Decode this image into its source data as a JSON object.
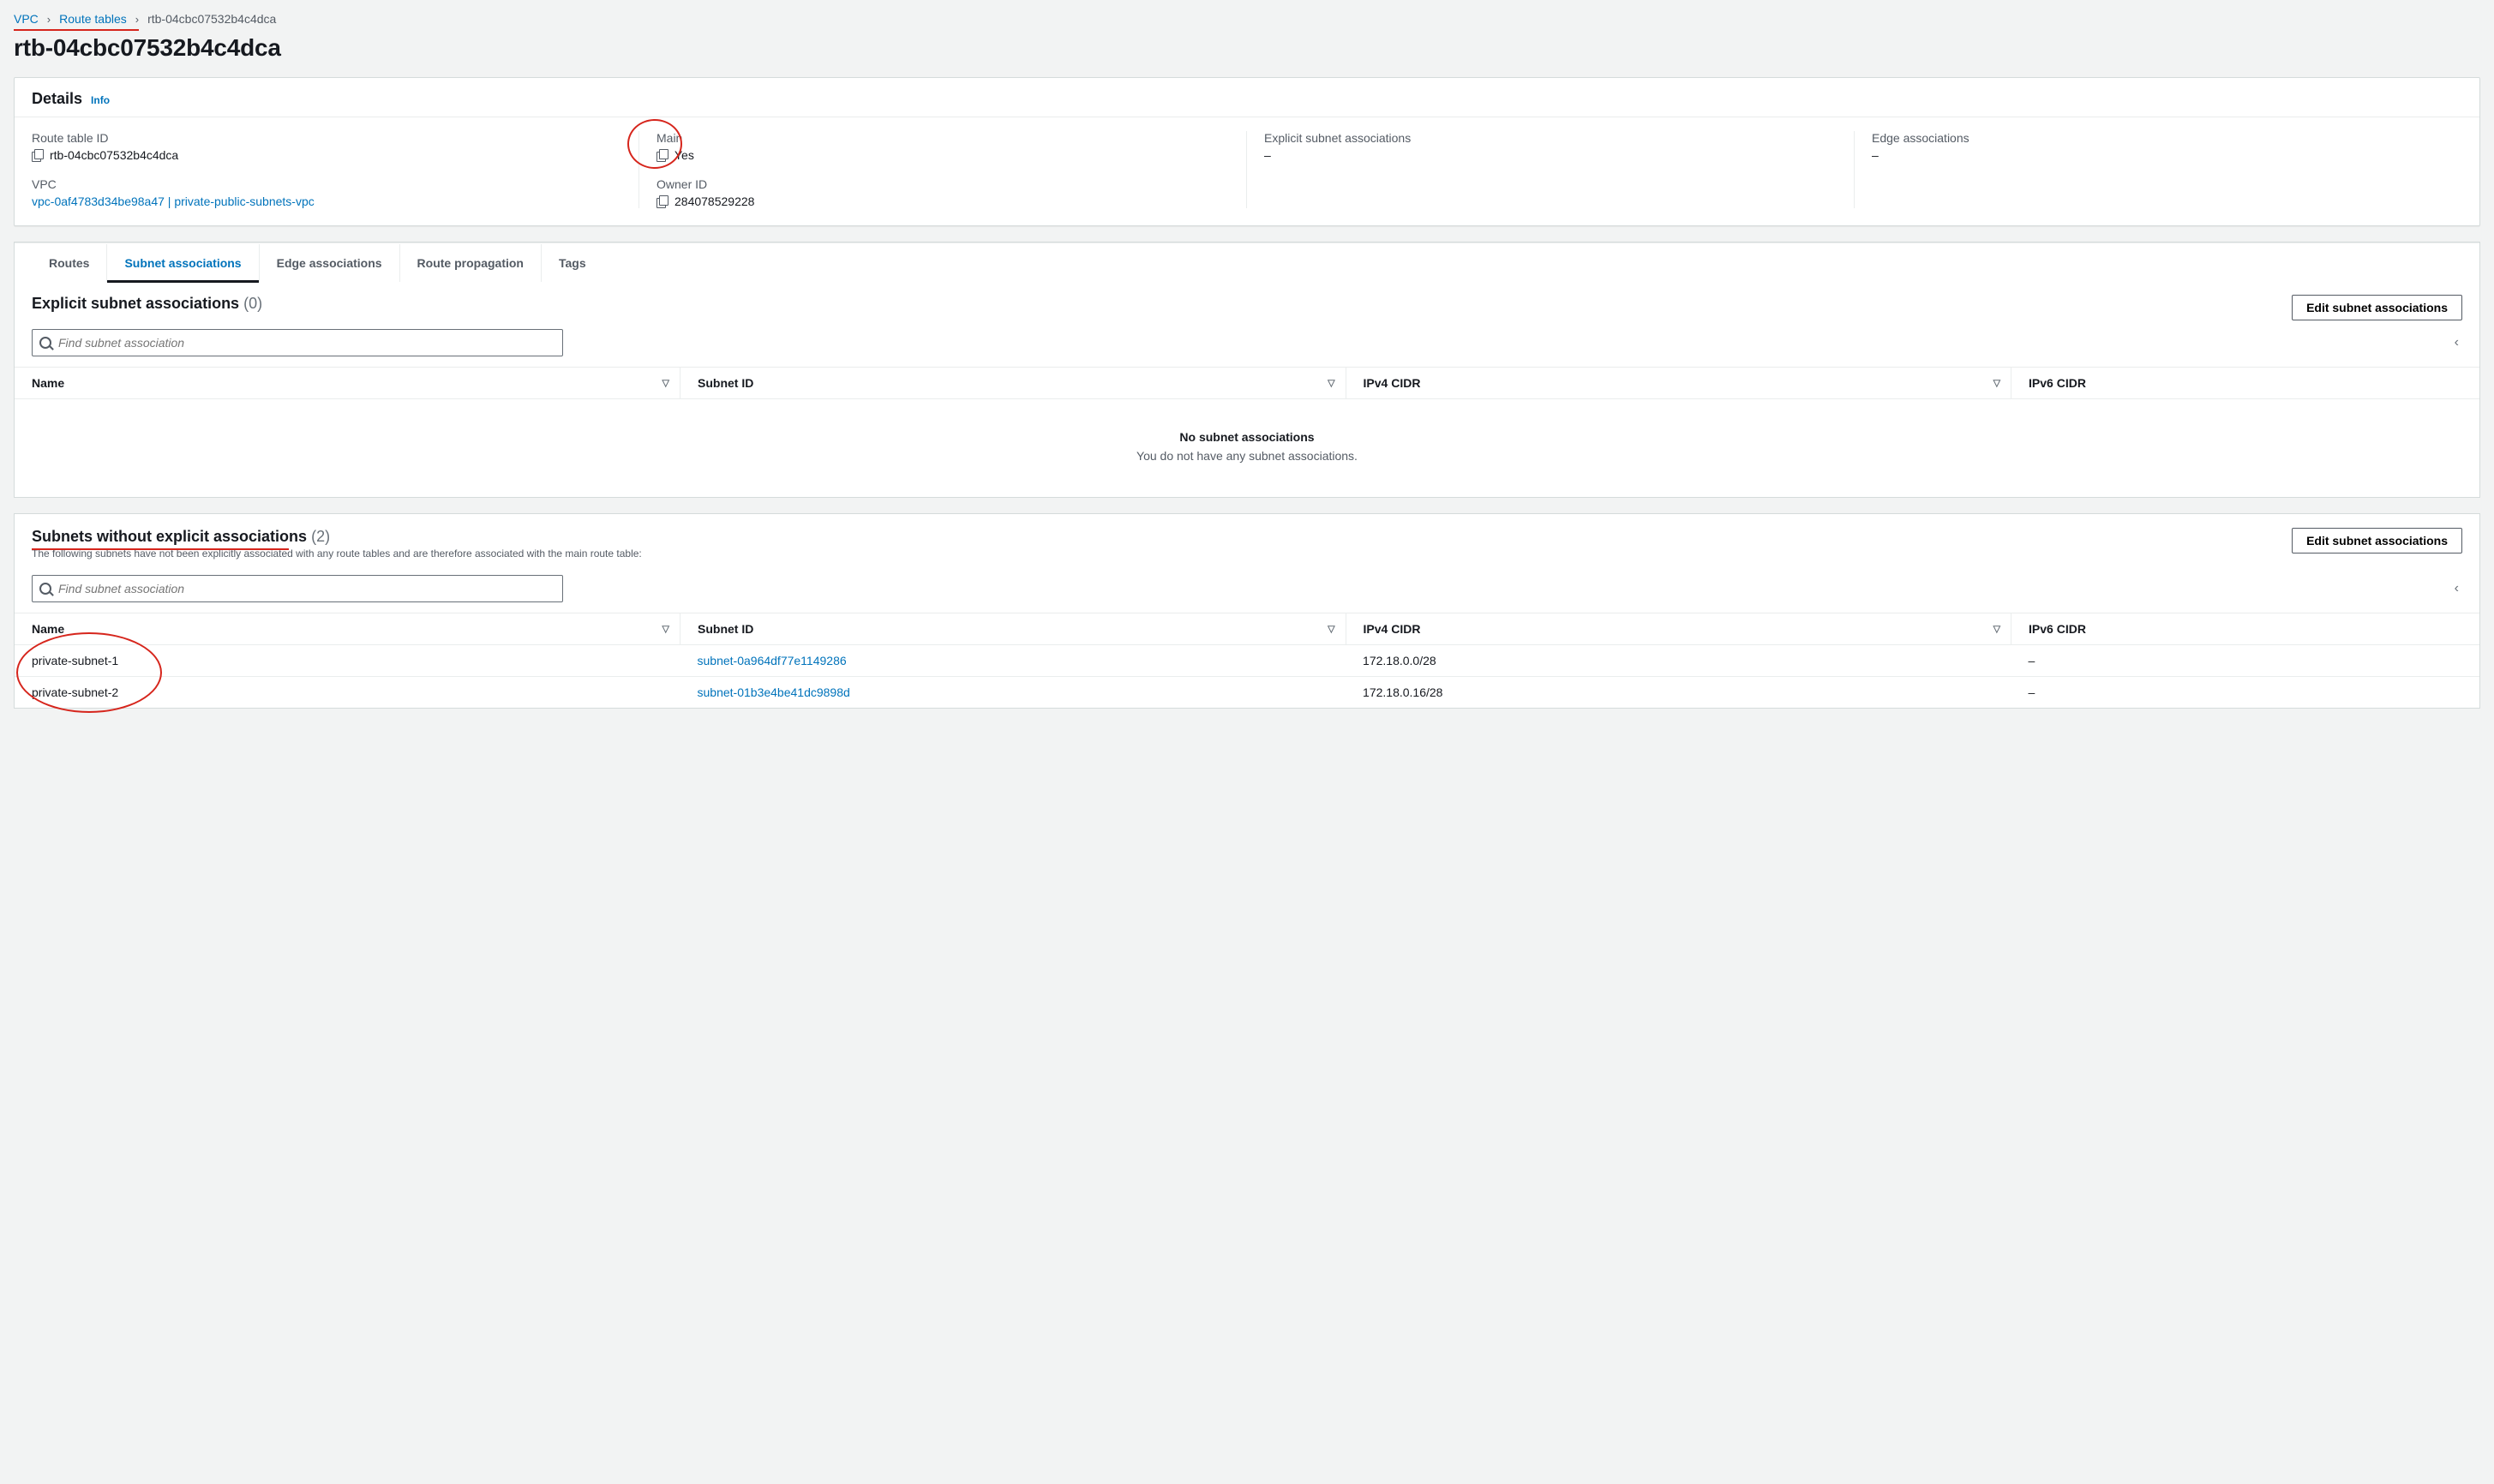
{
  "breadcrumb": {
    "vpc": "VPC",
    "route_tables": "Route tables",
    "current": "rtb-04cbc07532b4c4dca"
  },
  "title": "rtb-04cbc07532b4c4dca",
  "details": {
    "heading": "Details",
    "info": "Info",
    "route_table_id_label": "Route table ID",
    "route_table_id_value": "rtb-04cbc07532b4c4dca",
    "vpc_label": "VPC",
    "vpc_value": "vpc-0af4783d34be98a47 | private-public-subnets-vpc",
    "main_label": "Main",
    "main_value": "Yes",
    "owner_label": "Owner ID",
    "owner_value": "284078529228",
    "explicit_label": "Explicit subnet associations",
    "explicit_value": "–",
    "edge_label": "Edge associations",
    "edge_value": "–"
  },
  "tabs": {
    "routes": "Routes",
    "subnet_associations": "Subnet associations",
    "edge_associations": "Edge associations",
    "route_propagation": "Route propagation",
    "tags": "Tags"
  },
  "explicit_section": {
    "title": "Explicit subnet associations",
    "count": "(0)",
    "button": "Edit subnet associations",
    "search_placeholder": "Find subnet association",
    "columns": {
      "name": "Name",
      "subnet_id": "Subnet ID",
      "ipv4": "IPv4 CIDR",
      "ipv6": "IPv6 CIDR"
    },
    "empty_title": "No subnet associations",
    "empty_sub": "You do not have any subnet associations."
  },
  "implicit_section": {
    "title": "Subnets without explicit associations",
    "count": "(2)",
    "desc": "The following subnets have not been explicitly associated with any route tables and are therefore associated with the main route table:",
    "button": "Edit subnet associations",
    "search_placeholder": "Find subnet association",
    "columns": {
      "name": "Name",
      "subnet_id": "Subnet ID",
      "ipv4": "IPv4 CIDR",
      "ipv6": "IPv6 CIDR"
    },
    "rows": [
      {
        "name": "private-subnet-1",
        "subnet_id": "subnet-0a964df77e1149286",
        "ipv4": "172.18.0.0/28",
        "ipv6": "–"
      },
      {
        "name": "private-subnet-2",
        "subnet_id": "subnet-01b3e4be41dc9898d",
        "ipv4": "172.18.0.16/28",
        "ipv6": "–"
      }
    ]
  }
}
